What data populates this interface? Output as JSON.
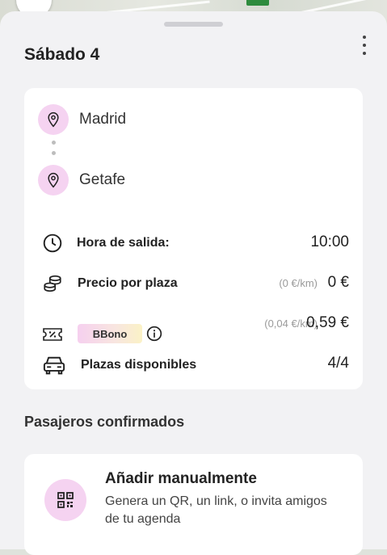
{
  "header": {
    "title": "Sábado 4"
  },
  "route": {
    "origin": "Madrid",
    "destination": "Getafe"
  },
  "trip": {
    "departure_label": "Hora de salida:",
    "departure_time": "10:00",
    "price_label": "Precio por plaza",
    "price_per_km": "(0 €/km)",
    "price_value": "0 €",
    "bbono_label": "BBono",
    "bbono_per_km": "(0,04 €/km)",
    "bbono_value": "0,59 €",
    "seats_label": "Plazas disponibles",
    "seats_value": "4/4"
  },
  "passengers": {
    "section_title": "Pasajeros confirmados",
    "add_title": "Añadir manualmente",
    "add_description": "Genera un QR, un link, o invita amigos de tu agenda"
  },
  "colors": {
    "pink_accent": "#f5d3f1",
    "sheet_bg": "#f2f2f4",
    "card_bg": "#ffffff"
  },
  "icons": {
    "pin": "map-pin-icon",
    "clock": "clock-icon",
    "coins": "coins-icon",
    "ticket": "discount-ticket-icon",
    "info": "info-icon",
    "car": "car-icon",
    "qr": "qr-code-icon",
    "menu": "more-vertical-icon"
  }
}
